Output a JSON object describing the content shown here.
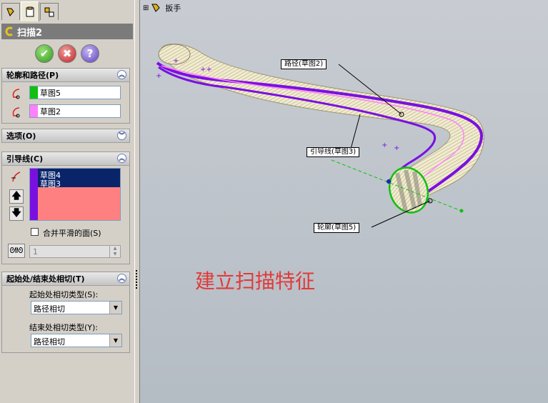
{
  "panel": {
    "feature_title": "扫描2",
    "confirm": {
      "ok": "✔",
      "cancel": "✖",
      "help": "?"
    }
  },
  "profile_path": {
    "header": "轮廓和路径(P)",
    "profile": {
      "value": "草图5",
      "color": "#10c010"
    },
    "path": {
      "value": "草图2",
      "color": "#ff80ff"
    }
  },
  "options": {
    "header": "选项(O)"
  },
  "guide_curves": {
    "header": "引导线(C)",
    "items": [
      "草图4",
      "草图3"
    ],
    "merge_label": "合并平滑的面(S)",
    "spin_value": "1"
  },
  "tangency": {
    "header": "起始处/结束处相切(T)",
    "start_label": "起始处相切类型(S):",
    "start_value": "路径相切",
    "end_label": "结束处相切类型(Y):",
    "end_value": "路径相切"
  },
  "tree": {
    "expand": "⊞",
    "root_label": "扳手"
  },
  "callouts": {
    "path": "路径(草图2)",
    "guide": "引导线(草图3)",
    "profile": "轮廓(草图5)"
  },
  "heading": "建立扫描特征",
  "colors": {
    "guide": "#7a10e0",
    "path": "#ff80ff",
    "profile": "#10c010"
  }
}
